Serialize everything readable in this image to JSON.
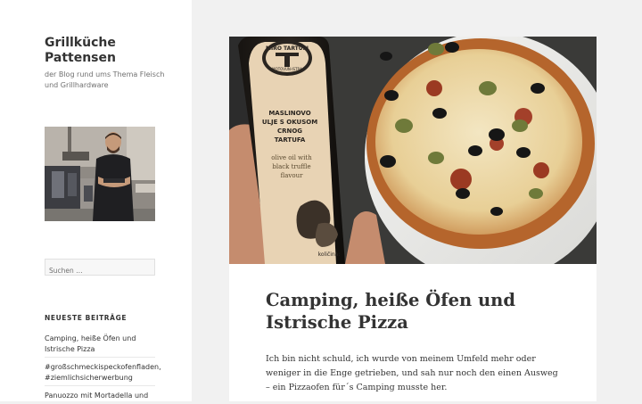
{
  "site": {
    "title": "Grillküche Pattensen",
    "description": "der Blog rund ums Thema Fleisch und Grillhardware"
  },
  "search": {
    "placeholder": "Suchen …"
  },
  "recent_posts": {
    "heading": "NEUESTE BEITRÄGE",
    "items": [
      "Camping, heiße Öfen und Istrische Pizza",
      "#großschmeckispeckofenfladen, #ziemlichsicherwerbung",
      "Panuozzo mit Mortadella und"
    ]
  },
  "post": {
    "title": "Camping, heiße Öfen und Istrische Pizza",
    "excerpt": "Ich bin nicht schuld, ich wurde von meinem Umfeld mehr oder weniger in die Enge getrieben, und sah nur noch den einen Ausweg – ein Pizzaofen für´s Camping musste her."
  },
  "bottle_label": {
    "brand": "MIRO TARTUFI",
    "origin": "MOTOVUN-ISTRA",
    "name_line1": "MASLINOVO",
    "name_line2": "ULJE S OKUSOM",
    "name_line3": "CRNOG",
    "name_line4": "TARTUFA",
    "english_line1": "olive oil with",
    "english_line2": "black truffle",
    "english_line3": "flavour",
    "quantity": "količina:"
  },
  "colors": {
    "sidebar_bg": "#ffffff",
    "page_bg": "#f1f1f1",
    "text": "#333333",
    "muted": "#707070",
    "label": "#e8d3b4"
  }
}
